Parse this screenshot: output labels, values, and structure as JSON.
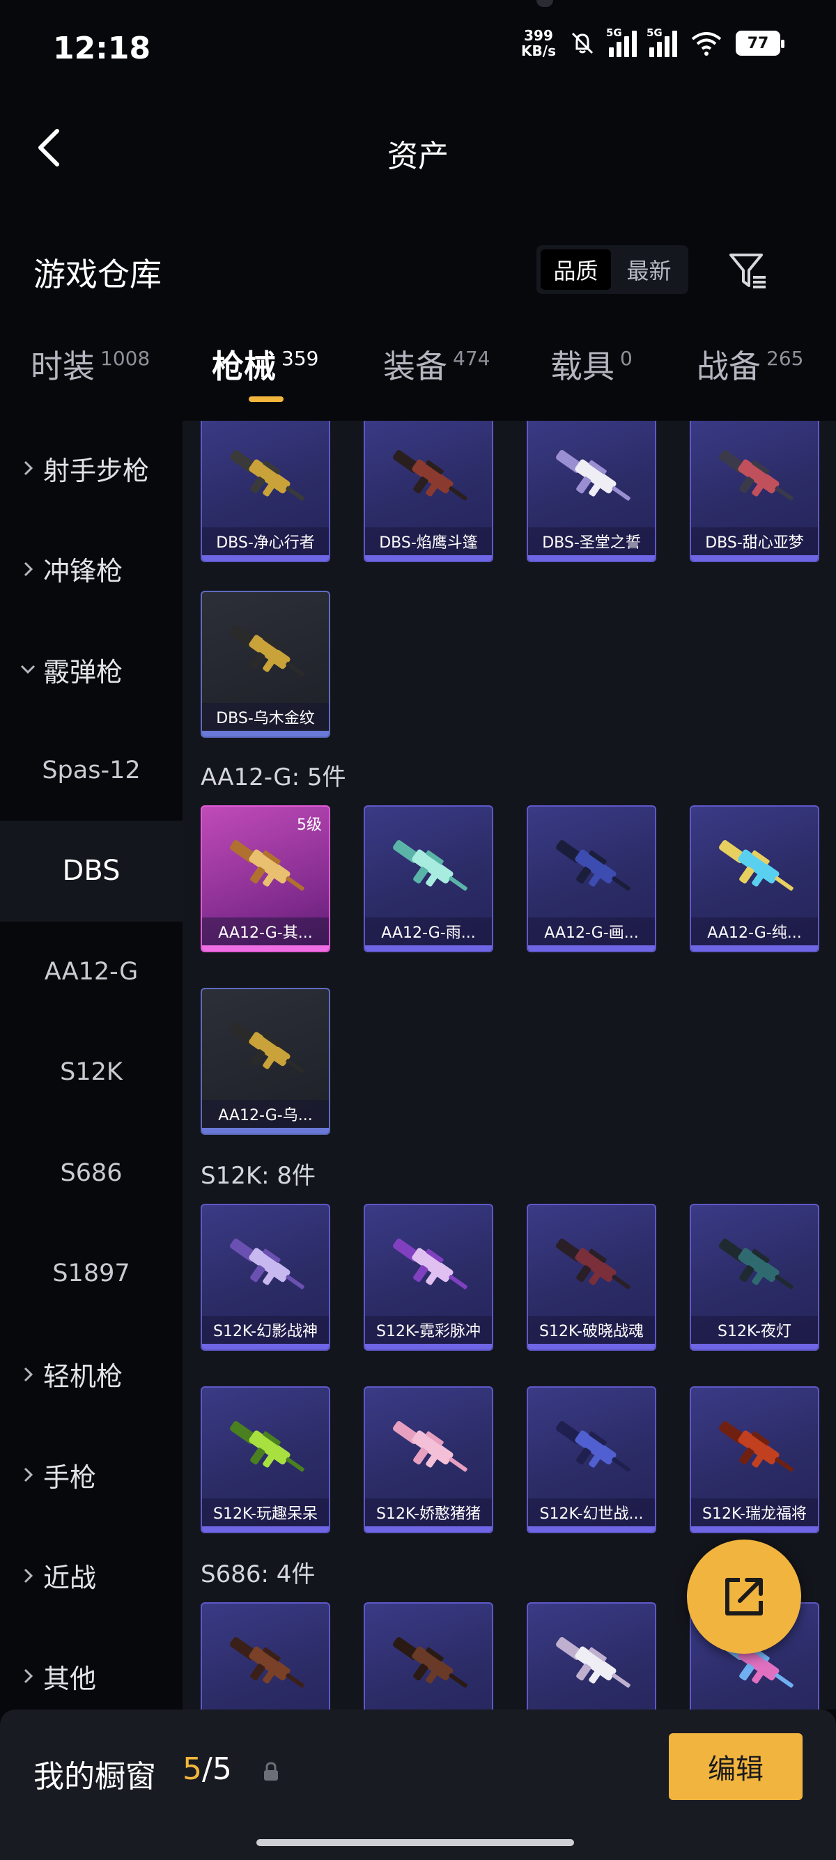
{
  "status": {
    "time": "12:18",
    "net_speed_value": "399",
    "net_speed_unit": "KB/s",
    "battery": "77",
    "sim1": "5G",
    "sim2": "5G"
  },
  "header": {
    "title": "资产"
  },
  "warehouse": {
    "title": "游戏仓库",
    "sort_options": [
      "品质",
      "最新"
    ],
    "active_sort": "品质"
  },
  "tabs": [
    {
      "label": "时装",
      "count": "1008"
    },
    {
      "label": "枪械",
      "count": "359"
    },
    {
      "label": "装备",
      "count": "474"
    },
    {
      "label": "载具",
      "count": "0"
    },
    {
      "label": "战备",
      "count": "265"
    }
  ],
  "active_tab": "枪械",
  "sidebar": {
    "items": [
      {
        "label": "射手步枪",
        "type": "category",
        "expanded": false
      },
      {
        "label": "冲锋枪",
        "type": "category",
        "expanded": false
      },
      {
        "label": "霰弹枪",
        "type": "category",
        "expanded": true
      },
      {
        "label": "Spas-12",
        "type": "sub"
      },
      {
        "label": "DBS",
        "type": "sub",
        "active": true
      },
      {
        "label": "AA12-G",
        "type": "sub"
      },
      {
        "label": "S12K",
        "type": "sub"
      },
      {
        "label": "S686",
        "type": "sub"
      },
      {
        "label": "S1897",
        "type": "sub"
      },
      {
        "label": "轻机枪",
        "type": "category",
        "expanded": false
      },
      {
        "label": "手枪",
        "type": "category",
        "expanded": false
      },
      {
        "label": "近战",
        "type": "category",
        "expanded": false
      },
      {
        "label": "其他",
        "type": "category",
        "expanded": false
      }
    ]
  },
  "grid": {
    "dbs_items": [
      {
        "name": "DBS-净心行者",
        "rarity": "purple",
        "colors": [
          "#c9a23a",
          "#3a3a3a"
        ]
      },
      {
        "name": "DBS-焰鹰斗篷",
        "rarity": "purple",
        "colors": [
          "#8a3a2e",
          "#2a1f1f"
        ]
      },
      {
        "name": "DBS-圣堂之誓",
        "rarity": "purple",
        "colors": [
          "#eeeef4",
          "#9a8fd0"
        ]
      },
      {
        "name": "DBS-甜心亚梦",
        "rarity": "purple",
        "colors": [
          "#c0505c",
          "#3a3a4a"
        ]
      },
      {
        "name": "DBS-乌木金纹",
        "rarity": "gray",
        "colors": [
          "#c9a23a",
          "#2a2a2a"
        ]
      }
    ],
    "aa12_section": "AA12-G: 5件",
    "aa12_items": [
      {
        "name": "AA12-G-其...",
        "rarity": "pink",
        "level": "5级",
        "colors": [
          "#e8c070",
          "#b07030"
        ]
      },
      {
        "name": "AA12-G-雨...",
        "rarity": "purple",
        "colors": [
          "#a8ece0",
          "#5ab4a8"
        ]
      },
      {
        "name": "AA12-G-画...",
        "rarity": "purple",
        "colors": [
          "#3c4cb0",
          "#1a1e3a"
        ]
      },
      {
        "name": "AA12-G-纯...",
        "rarity": "purple",
        "colors": [
          "#5ad0f0",
          "#e8d060"
        ]
      },
      {
        "name": "AA12-G-乌...",
        "rarity": "gray",
        "colors": [
          "#c9a23a",
          "#2a2a2a"
        ]
      }
    ],
    "s12k_section": "S12K: 8件",
    "s12k_items": [
      {
        "name": "S12K-幻影战神",
        "rarity": "purple",
        "colors": [
          "#c8b8f0",
          "#6a50b0"
        ]
      },
      {
        "name": "S12K-霓彩脉冲",
        "rarity": "purple",
        "colors": [
          "#e0c0f0",
          "#8040c0"
        ]
      },
      {
        "name": "S12K-破晓战魂",
        "rarity": "purple",
        "colors": [
          "#7a2f3a",
          "#2a1f26"
        ]
      },
      {
        "name": "S12K-夜灯",
        "rarity": "purple",
        "colors": [
          "#2f6a70",
          "#1e2a30"
        ]
      },
      {
        "name": "S12K-玩趣呆呆",
        "rarity": "purple",
        "colors": [
          "#a8e040",
          "#4a8020"
        ]
      },
      {
        "name": "S12K-娇憨猪猪",
        "rarity": "purple",
        "colors": [
          "#f4c0d8",
          "#e8a0c0"
        ]
      },
      {
        "name": "S12K-幻世战...",
        "rarity": "purple",
        "colors": [
          "#5060d0",
          "#202050"
        ]
      },
      {
        "name": "S12K-瑞龙福将",
        "rarity": "purple",
        "colors": [
          "#c04020",
          "#702010"
        ]
      }
    ],
    "s686_section": "S686: 4件",
    "s686_items": [
      {
        "name": "",
        "rarity": "purple",
        "colors": [
          "#7a4028",
          "#3a2018"
        ]
      },
      {
        "name": "",
        "rarity": "purple",
        "colors": [
          "#6a3a28",
          "#2a1a14"
        ]
      },
      {
        "name": "",
        "rarity": "purple",
        "colors": [
          "#eeeef4",
          "#c0b0d0"
        ]
      },
      {
        "name": "",
        "rarity": "purple",
        "colors": [
          "#e070c0",
          "#70b0f0"
        ]
      }
    ]
  },
  "showcase": {
    "label": "我的橱窗",
    "current": "5",
    "separator": "/",
    "total": "5",
    "edit_label": "编辑"
  },
  "accent_color": "#f2b63c"
}
